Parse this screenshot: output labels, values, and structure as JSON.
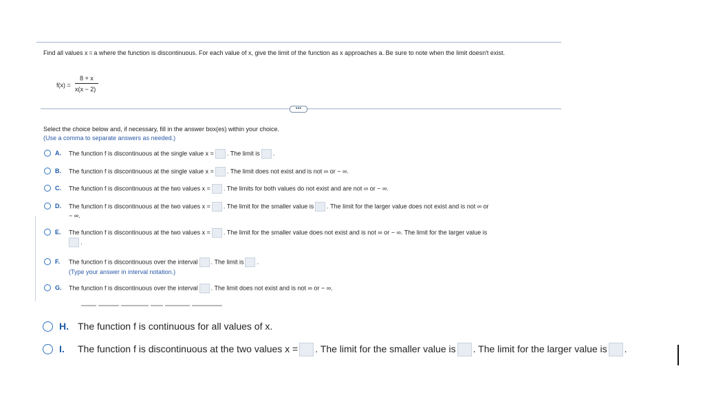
{
  "prompt": "Find all values x = a where the function is discontinuous. For each value of x, give the limit of the function as x approaches a. Be sure to note when the limit doesn't exist.",
  "function": {
    "lhs": "f(x) =",
    "numerator": "8 + x",
    "denominator": "x(x − 2)"
  },
  "divider_label": "•••",
  "instructions": "Select the choice below and, if necessary, fill in the answer box(es) within your choice.",
  "hint": "(Use a comma to separate answers as needed.)",
  "options": {
    "A": {
      "letter": "A.",
      "p1": "The function f is discontinuous at the single value x =",
      "p2": ". The limit is",
      "p3": "."
    },
    "B": {
      "letter": "B.",
      "p1": "The function f is discontinuous at the single value x =",
      "p2": ". The limit does not exist and is not ∞ or − ∞."
    },
    "C": {
      "letter": "C.",
      "p1": "The function f is discontinuous at the two values x =",
      "p2": ". The limits for both values do not exist and are not ∞ or − ∞."
    },
    "D": {
      "letter": "D.",
      "p1": "The function f is discontinuous at the two values x =",
      "p2": ". The limit for the smaller value is",
      "p3": ". The limit for the larger value does not exist and is not ∞ or",
      "p4": "− ∞."
    },
    "E": {
      "letter": "E.",
      "p1": "The function f is discontinuous at the two values x =",
      "p2": ". The limit for the smaller value does not exist and is not ∞ or − ∞. The limit for the larger value is",
      "p3": "."
    },
    "F": {
      "letter": "F.",
      "p1": "The function f is discontinuous over the interval",
      "p2": ". The limit is",
      "p3": ".",
      "hint": "(Type your answer in interval notation.)"
    },
    "G": {
      "letter": "G.",
      "p1": "The function f is discontinuous over the interval",
      "p2": ". The limit does not exist and is not ∞ or − ∞."
    },
    "H": {
      "letter": "H.",
      "p1": "The function f is continuous for all values of x."
    },
    "I": {
      "letter": "I.",
      "p1": "The function f is discontinuous at the two values x =",
      "p2": ". The limit for the smaller value is",
      "p3": ". The limit for the larger value is",
      "p4": "."
    }
  },
  "colors": {
    "accent": "#1e5aa8",
    "hint": "#2a5aa8",
    "rule": "#9fb3c8",
    "answer_box": "#e8edf3"
  }
}
